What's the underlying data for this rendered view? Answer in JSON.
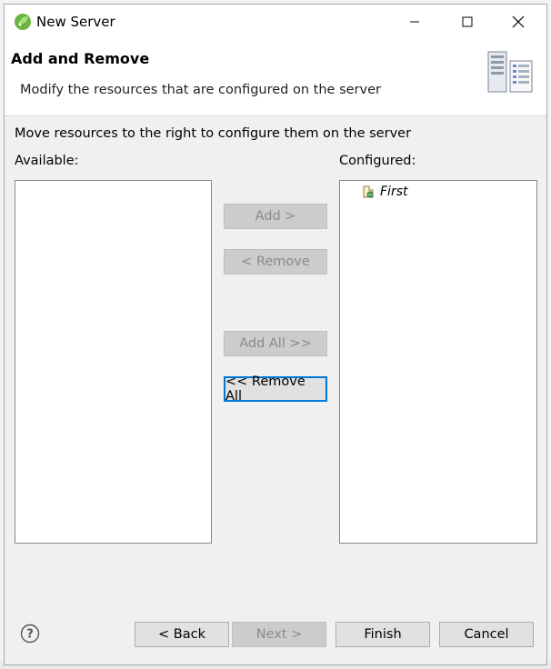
{
  "window": {
    "title": "New Server"
  },
  "header": {
    "title": "Add and Remove",
    "description": "Modify the resources that are configured on the server"
  },
  "main": {
    "instruction": "Move resources to the right to configure them on the server",
    "available_label": "Available:",
    "configured_label": "Configured:",
    "available_items": [],
    "configured_items": [
      {
        "label": "First",
        "icon": "web-project-icon"
      }
    ]
  },
  "transfer_buttons": {
    "add": "Add >",
    "remove": "< Remove",
    "add_all": "Add All >>",
    "remove_all": "<< Remove All"
  },
  "footer": {
    "help_icon": "help-icon",
    "back": "< Back",
    "next": "Next >",
    "finish": "Finish",
    "cancel": "Cancel"
  },
  "colors": {
    "focus_border": "#0078d7",
    "disabled_text": "#8a8a8a"
  }
}
